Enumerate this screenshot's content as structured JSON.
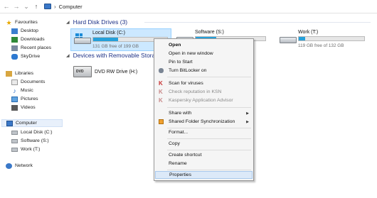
{
  "address": {
    "crumb": "Computer",
    "separator": "›"
  },
  "sidebar": {
    "favourites": "Favourites",
    "fav_items": [
      "Desktop",
      "Downloads",
      "Recent places",
      "SkyDrive"
    ],
    "libraries": "Libraries",
    "lib_items": [
      "Documents",
      "Music",
      "Pictures",
      "Videos"
    ],
    "computer": "Computer",
    "comp_items": [
      "Local Disk (C:)",
      "Software (S:)",
      "Work (T:)"
    ],
    "network": "Network"
  },
  "groups": {
    "hdd": "Hard Disk Drives (3)",
    "removable": "Devices with Removable Stora"
  },
  "drives": [
    {
      "name": "Local Disk (C:)",
      "free": "131 GB free of 199 GB",
      "used_fraction": 0.34
    },
    {
      "name": "Software (S:)",
      "free": "",
      "used_fraction": 0.3
    },
    {
      "name": "Work (T:)",
      "free": "119 GB free of 132 GB",
      "used_fraction": 0.1
    }
  ],
  "dvd": {
    "name": "DVD RW Drive (H:)",
    "badge": "DVD"
  },
  "menu": {
    "open": "Open",
    "open_new": "Open in new window",
    "pin": "Pin to Start",
    "bitlocker": "Turn BitLocker on",
    "scan": "Scan for viruses",
    "ksn": "Check reputation in KSN",
    "kaspersky": "Kaspersky Application Advisor",
    "share": "Share with",
    "sync": "Shared Folder Synchronization",
    "format": "Format...",
    "copy": "Copy",
    "shortcut": "Create shortcut",
    "rename": "Rename",
    "properties": "Properties"
  },
  "colors": {
    "accent": "#26a0da",
    "selection": "#cce8ff",
    "group_heading": "#1e3287"
  }
}
